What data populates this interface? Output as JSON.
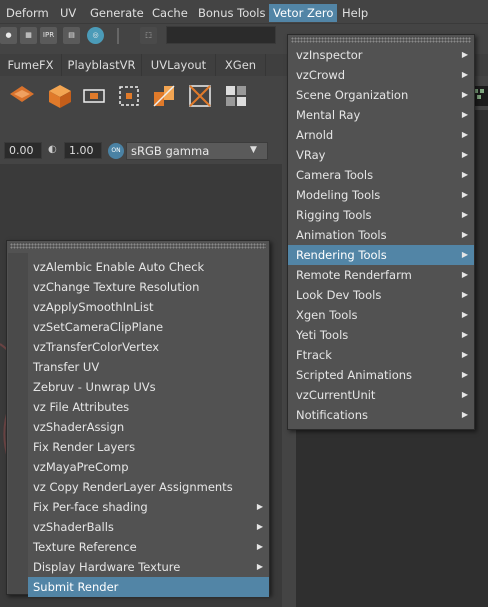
{
  "menubar": {
    "items": [
      "Deform",
      "UV",
      "Generate",
      "Cache",
      "Bonus Tools",
      "Vetor Zero",
      "Help"
    ],
    "active": "Vetor Zero"
  },
  "toolbar": {
    "icons": [
      "record-icon",
      "clapper-icon",
      "ipr-icon",
      "render-settings-icon",
      "hypershade-icon",
      "select-tool-icon"
    ],
    "ipr_label": "IPR"
  },
  "shelf": {
    "tabs": [
      "FumeFX",
      "PlayblastVR",
      "UVLayout",
      "XGen"
    ]
  },
  "color_row": {
    "value1": "0.00",
    "value2": "1.00",
    "on_label": "ON",
    "gamma": "sRGB gamma"
  },
  "vetor_menu": {
    "items": [
      {
        "label": "vzInspector",
        "submenu": true
      },
      {
        "label": "vzCrowd",
        "submenu": true
      },
      {
        "label": "Scene Organization",
        "submenu": true
      },
      {
        "label": "Mental Ray",
        "submenu": true
      },
      {
        "label": "Arnold",
        "submenu": true
      },
      {
        "label": "VRay",
        "submenu": true
      },
      {
        "label": "Camera Tools",
        "submenu": true
      },
      {
        "label": "Modeling Tools",
        "submenu": true
      },
      {
        "label": "Rigging Tools",
        "submenu": true
      },
      {
        "label": "Animation Tools",
        "submenu": true
      },
      {
        "label": "Rendering Tools",
        "submenu": true,
        "highlighted": true
      },
      {
        "label": "Remote Renderfarm",
        "submenu": true
      },
      {
        "label": "Look Dev Tools",
        "submenu": true
      },
      {
        "label": "Xgen Tools",
        "submenu": true
      },
      {
        "label": "Yeti Tools",
        "submenu": true
      },
      {
        "label": "Ftrack",
        "submenu": true
      },
      {
        "label": "Scripted Animations",
        "submenu": true
      },
      {
        "label": "vzCurrentUnit",
        "submenu": true
      },
      {
        "label": "Notifications",
        "submenu": true
      }
    ]
  },
  "rendering_menu": {
    "items": [
      {
        "label": "vzAlembic Enable Auto Check",
        "submenu": false
      },
      {
        "label": "vzChange Texture Resolution",
        "submenu": false
      },
      {
        "label": "vzApplySmoothInList",
        "submenu": false
      },
      {
        "label": "vzSetCameraClipPlane",
        "submenu": false
      },
      {
        "label": "vzTransferColorVertex",
        "submenu": false
      },
      {
        "label": "Transfer UV",
        "submenu": false
      },
      {
        "label": "Zebruv - Unwrap UVs",
        "submenu": false
      },
      {
        "label": "vz File Attributes",
        "submenu": false
      },
      {
        "label": "vzShaderAssign",
        "submenu": false
      },
      {
        "label": "Fix Render Layers",
        "submenu": false
      },
      {
        "label": "vzMayaPreComp",
        "submenu": false
      },
      {
        "label": "vz Copy RenderLayer Assignments",
        "submenu": false
      },
      {
        "label": "Fix Per-face shading",
        "submenu": true
      },
      {
        "label": "vzShaderBalls",
        "submenu": true
      },
      {
        "label": "Texture Reference",
        "submenu": true
      },
      {
        "label": "Display Hardware Texture",
        "submenu": true
      },
      {
        "label": "Submit Render",
        "submenu": false,
        "highlighted": true
      }
    ]
  },
  "colors": {
    "accent": "#5285a6",
    "menu_bg": "#525252",
    "app_bg": "#444444"
  }
}
